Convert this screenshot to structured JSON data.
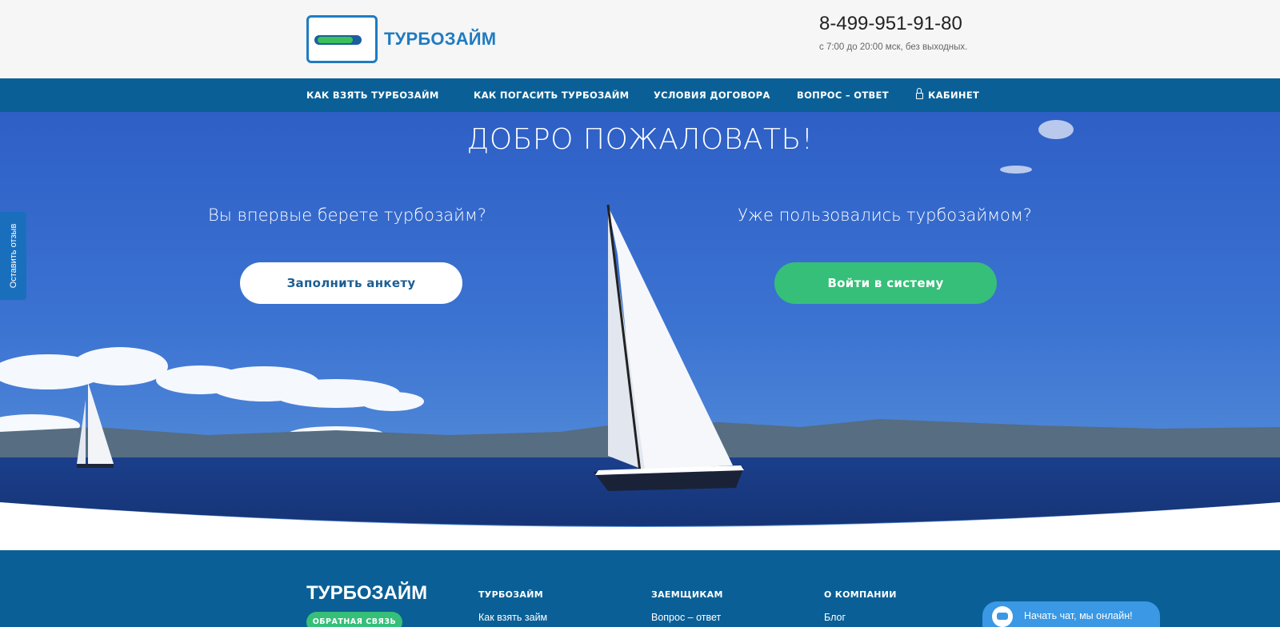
{
  "header": {
    "logo_text": "ТУРБОЗАЙМ",
    "phone": "8-499-951-91-80",
    "hours": "с 7:00 до 20:00 мск, без выходных."
  },
  "nav": {
    "items": [
      {
        "label": "КАК ВЗЯТЬ ТУРБОЗАЙМ"
      },
      {
        "label": "КАК ПОГАСИТЬ ТУРБОЗАЙМ"
      },
      {
        "label": "УСЛОВИЯ ДОГОВОРА"
      },
      {
        "label": "ВОПРОС – ОТВЕТ"
      },
      {
        "label": "КАБИНЕТ",
        "icon": "lock-icon"
      }
    ]
  },
  "hero": {
    "title": "ДОБРО ПОЖАЛОВАТЬ!",
    "left_question": "Вы впервые берете турбозайм?",
    "left_button": "Заполнить анкету",
    "right_question": "Уже пользовались турбозаймом?",
    "right_button": "Войти в систему"
  },
  "feedback_tab": {
    "label": "Оставить отзыв"
  },
  "footer": {
    "logo_text": "ТУРБОЗАЙМ",
    "contact_button": "ОБРАТНАЯ СВЯЗЬ",
    "columns": [
      {
        "heading": "ТУРБОЗАЙМ",
        "first_link": "Как взять займ"
      },
      {
        "heading": "ЗАЕМЩИКАМ",
        "first_link": "Вопрос – ответ"
      },
      {
        "heading": "О КОМПАНИИ",
        "first_link": "Блог"
      }
    ]
  },
  "chat": {
    "label": "Начать чат, мы онлайн!",
    "icon": "chat-icon"
  },
  "colors": {
    "nav_bg": "#0a6096",
    "brand_blue": "#1f7cc2",
    "green": "#36bf79",
    "sky": "#3b6fce"
  }
}
